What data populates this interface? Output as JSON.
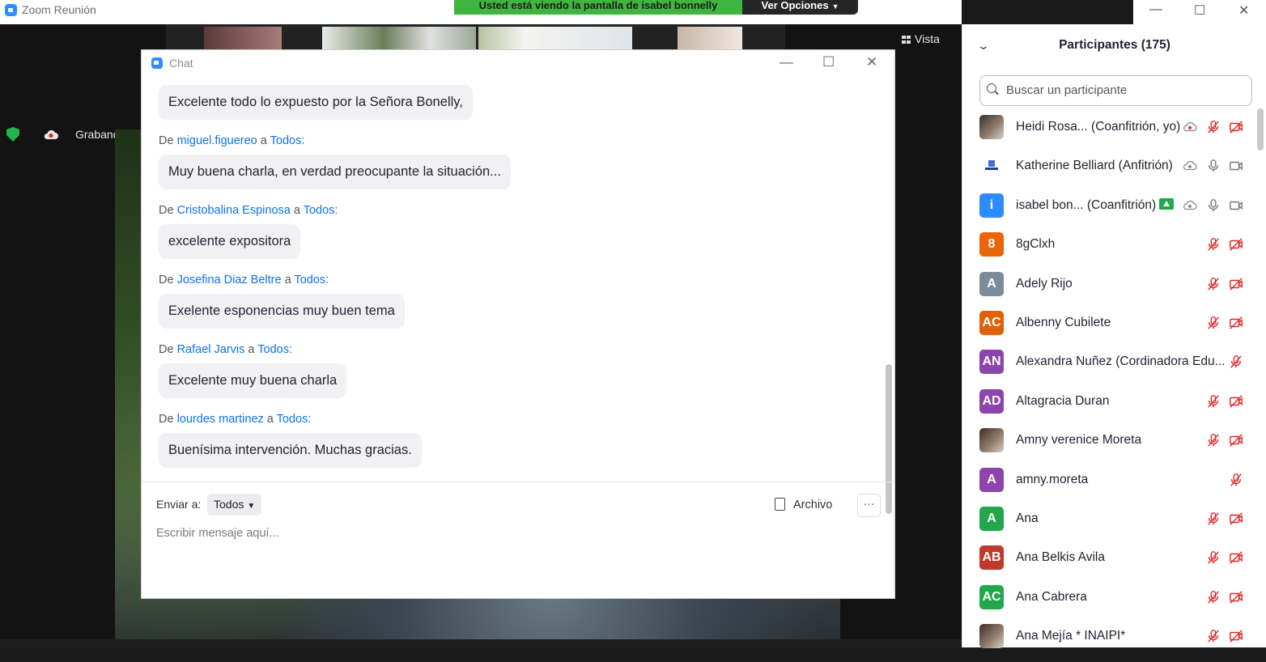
{
  "app": {
    "title": "Zoom Reunión"
  },
  "banner": {
    "sharing_text": "Usted está viendo la pantalla de isabel bonnelly",
    "options_label": "Ver Opciones"
  },
  "window_controls": {
    "minimize": "—",
    "maximize": "☐",
    "close": "✕"
  },
  "video": {
    "view_label": "Vista",
    "recording_label": "Grabando..."
  },
  "chat": {
    "title": "Chat",
    "messages": [
      {
        "from": "",
        "to": "",
        "text": "Excelente todo lo expuesto por la Señora Bonelly,"
      },
      {
        "from": "miguel.figuereo",
        "to": "Todos",
        "text": "Muy buena charla, en verdad preocupante la situación..."
      },
      {
        "from": "Cristobalina Espinosa",
        "to": "Todos",
        "text": "excelente expositora"
      },
      {
        "from": "Josefina Diaz Beltre",
        "to": "Todos",
        "text": "Exelente esponencias muy buen tema"
      },
      {
        "from": "Rafael Jarvis",
        "to": "Todos",
        "text": "Excelente muy buena charla"
      },
      {
        "from": "lourdes martinez",
        "to": "Todos",
        "text": "Buenísima intervención. Muchas gracias."
      }
    ],
    "from_prefix": "De",
    "to_word": "a",
    "to_suffix": ":",
    "send_to_label": "Enviar a:",
    "send_to_value": "Todos",
    "file_label": "Archivo",
    "more_label": "···",
    "input_placeholder": "Escribir mensaje aquí..."
  },
  "participants": {
    "title": "Participantes (175)",
    "search_placeholder": "Buscar un participante",
    "list": [
      {
        "name": "Heidi Rosa...  (Coanfitrión, yo)",
        "avatar_text": "",
        "avatar_color": "",
        "avatar_type": "photo",
        "cloud": true,
        "cloud_red": true,
        "mic_muted": true,
        "cam_off": true,
        "share": false
      },
      {
        "name": "Katherine Belliard (Anfitrión)",
        "avatar_text": "",
        "avatar_color": "",
        "avatar_type": "logo",
        "cloud": true,
        "cloud_red": false,
        "mic_muted": false,
        "cam_off": false,
        "share": false
      },
      {
        "name": "isabel bon...  (Coanfitrión)",
        "avatar_text": "i",
        "avatar_color": "#2d8cff",
        "avatar_type": "letter",
        "cloud": true,
        "cloud_red": false,
        "mic_muted": false,
        "cam_off": false,
        "share": true
      },
      {
        "name": "8gClxh",
        "avatar_text": "8",
        "avatar_color": "#e8650a",
        "avatar_type": "letter",
        "mic_muted": true,
        "cam_off": true
      },
      {
        "name": "Adely Rijo",
        "avatar_text": "A",
        "avatar_color": "#7b8b99",
        "avatar_type": "letter",
        "mic_muted": true,
        "cam_off": true
      },
      {
        "name": "Albenny Cubilete",
        "avatar_text": "AC",
        "avatar_color": "#e0600c",
        "avatar_type": "letter",
        "mic_muted": true,
        "cam_off": true
      },
      {
        "name": "Alexandra Nuñez (Cordinadora Edu...",
        "avatar_text": "AN",
        "avatar_color": "#8e44ad",
        "avatar_type": "letter",
        "mic_muted": true,
        "cam_off": false
      },
      {
        "name": "Altagracia Duran",
        "avatar_text": "AD",
        "avatar_color": "#8e44ad",
        "avatar_type": "letter",
        "mic_muted": true,
        "cam_off": true
      },
      {
        "name": "Amny verenice Moreta",
        "avatar_text": "",
        "avatar_color": "",
        "avatar_type": "photo",
        "mic_muted": true,
        "cam_off": true
      },
      {
        "name": "amny.moreta",
        "avatar_text": "A",
        "avatar_color": "#8e44ad",
        "avatar_type": "letter",
        "mic_muted": true,
        "cam_off": false
      },
      {
        "name": "Ana",
        "avatar_text": "A",
        "avatar_color": "#22a84b",
        "avatar_type": "letter",
        "mic_muted": true,
        "cam_off": true
      },
      {
        "name": "Ana Belkis Avila",
        "avatar_text": "AB",
        "avatar_color": "#c0392b",
        "avatar_type": "letter",
        "mic_muted": true,
        "cam_off": true
      },
      {
        "name": "Ana Cabrera",
        "avatar_text": "AC",
        "avatar_color": "#22a84b",
        "avatar_type": "letter",
        "mic_muted": true,
        "cam_off": true
      },
      {
        "name": "Ana Mejía * INAIPI*",
        "avatar_text": "",
        "avatar_color": "",
        "avatar_type": "photo",
        "mic_muted": true,
        "cam_off": true
      }
    ]
  },
  "colors": {
    "accent": "#0e72ed",
    "banner_green": "#3fb53f",
    "muted_red": "#e02828"
  }
}
